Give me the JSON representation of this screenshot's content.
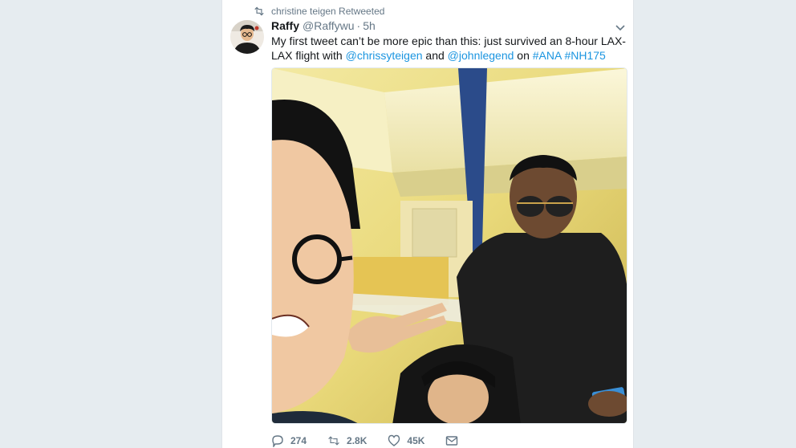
{
  "retweet": {
    "label": "christine teigen Retweeted",
    "icon": "retweet-icon"
  },
  "tweet": {
    "name": "Raffy",
    "handle": "@Raffywu",
    "separator": "·",
    "time": "5h",
    "text_parts": {
      "t1": "My first tweet can’t be more epic than this: just survived an 8-hour LAX-LAX flight with ",
      "m1": "@chrissyteigen",
      "t2": " and ",
      "m2": "@johnlegend",
      "t3": " on ",
      "h1": "#ANA",
      "t4": " ",
      "h2": "#NH175"
    }
  },
  "actions": {
    "reply_count": "274",
    "retweet_count": "2.8K",
    "like_count": "45K"
  },
  "colors": {
    "link": "#1b95e0",
    "muted": "#657786",
    "text": "#14171a",
    "background": "#e6ecf0"
  }
}
